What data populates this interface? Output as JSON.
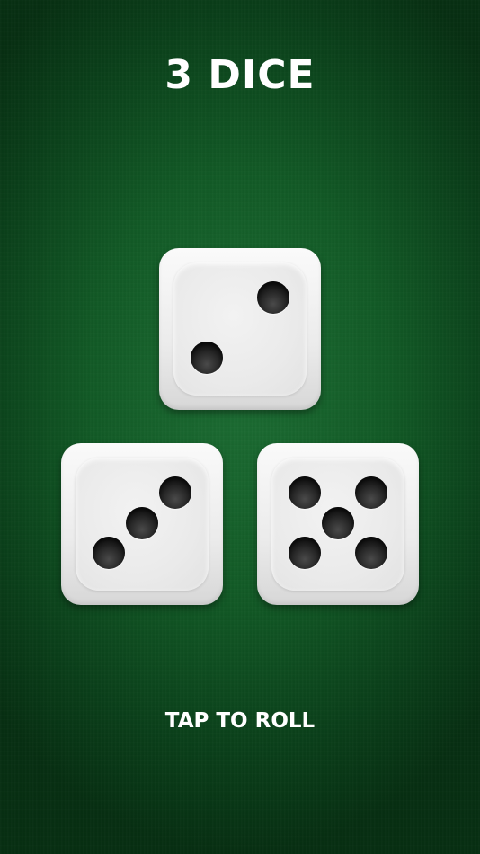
{
  "title": "3 DICE",
  "dice": [
    {
      "name": "die-top",
      "value": 2
    },
    {
      "name": "die-bottom-left",
      "value": 3
    },
    {
      "name": "die-bottom-right",
      "value": 5
    }
  ],
  "action_label": "TAP TO ROLL",
  "colors": {
    "felt": "#125a26",
    "die": "#f2f2f2",
    "pip": "#1e1e1e",
    "text": "#ffffff"
  }
}
